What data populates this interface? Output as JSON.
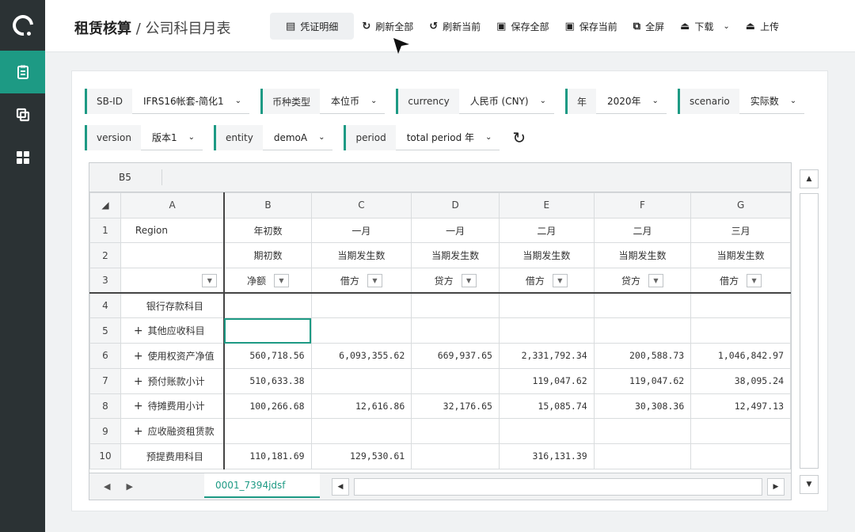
{
  "header": {
    "title_main": "租赁核算",
    "title_sep": " / ",
    "title_sub": "公司科目月表"
  },
  "toolbar": [
    {
      "id": "voucher",
      "icon": "voucher-icon",
      "label": "凭证明细"
    },
    {
      "id": "refresh-all",
      "icon": "refresh-icon",
      "label": "刷新全部"
    },
    {
      "id": "refresh-current",
      "icon": "refresh-current-icon",
      "label": "刷新当前"
    },
    {
      "id": "save-all",
      "icon": "save-icon",
      "label": "保存全部"
    },
    {
      "id": "save-current",
      "icon": "save-icon",
      "label": "保存当前"
    },
    {
      "id": "fullscreen",
      "icon": "fullscreen-icon",
      "label": "全屏"
    },
    {
      "id": "download",
      "icon": "download-icon",
      "label": "下载"
    },
    {
      "id": "upload",
      "icon": "upload-icon",
      "label": "上传"
    }
  ],
  "filters": {
    "row1": [
      {
        "label": "SB-ID",
        "value": "IFRS16帐套-简化1"
      },
      {
        "label": "币种类型",
        "value": "本位币"
      },
      {
        "label": "currency",
        "value": "人民币 (CNY)"
      },
      {
        "label": "年",
        "value": "2020年"
      },
      {
        "label": "scenario",
        "value": "实际数"
      }
    ],
    "row2": [
      {
        "label": "version",
        "value": "版本1"
      },
      {
        "label": "entity",
        "value": "demoA"
      },
      {
        "label": "period",
        "value": "total period 年"
      }
    ]
  },
  "sheet": {
    "cell_ref": "B5",
    "columns": [
      "A",
      "B",
      "C",
      "D",
      "E",
      "F",
      "G"
    ],
    "header_rows": [
      [
        "Region",
        "年初数",
        "一月",
        "一月",
        "二月",
        "二月",
        "三月"
      ],
      [
        "",
        "期初数",
        "当期发生数",
        "当期发生数",
        "当期发生数",
        "当期发生数",
        "当期发生数"
      ],
      [
        "",
        "净额",
        "借方",
        "贷方",
        "借方",
        "贷方",
        "借方"
      ]
    ],
    "rows": [
      {
        "num": "4",
        "label": "银行存款科目",
        "expand": "",
        "values": [
          "",
          "",
          "",
          "",
          "",
          ""
        ]
      },
      {
        "num": "5",
        "label": "其他应收科目",
        "expand": "+",
        "values": [
          "",
          "",
          "",
          "",
          "",
          ""
        ]
      },
      {
        "num": "6",
        "label": "使用权资产净值",
        "expand": "+",
        "values": [
          "560,718.56",
          "6,093,355.62",
          "669,937.65",
          "2,331,792.34",
          "200,588.73",
          "1,046,842.97"
        ]
      },
      {
        "num": "7",
        "label": "预付账款小计",
        "expand": "+",
        "values": [
          "510,633.38",
          "",
          "",
          "119,047.62",
          "119,047.62",
          "38,095.24"
        ]
      },
      {
        "num": "8",
        "label": "待摊费用小计",
        "expand": "+",
        "values": [
          "100,266.68",
          "12,616.86",
          "32,176.65",
          "15,085.74",
          "30,308.36",
          "12,497.13"
        ]
      },
      {
        "num": "9",
        "label": "应收融资租赁款",
        "expand": "+",
        "values": [
          "",
          "",
          "",
          "",
          "",
          ""
        ]
      },
      {
        "num": "10",
        "label": "预提费用科目",
        "expand": "",
        "values": [
          "110,181.69",
          "129,530.61",
          "",
          "316,131.39",
          "",
          ""
        ]
      }
    ],
    "tab_name": "0001_7394jdsf"
  },
  "colors": {
    "accent": "#1d9a84",
    "sidebar": "#2b3234"
  }
}
